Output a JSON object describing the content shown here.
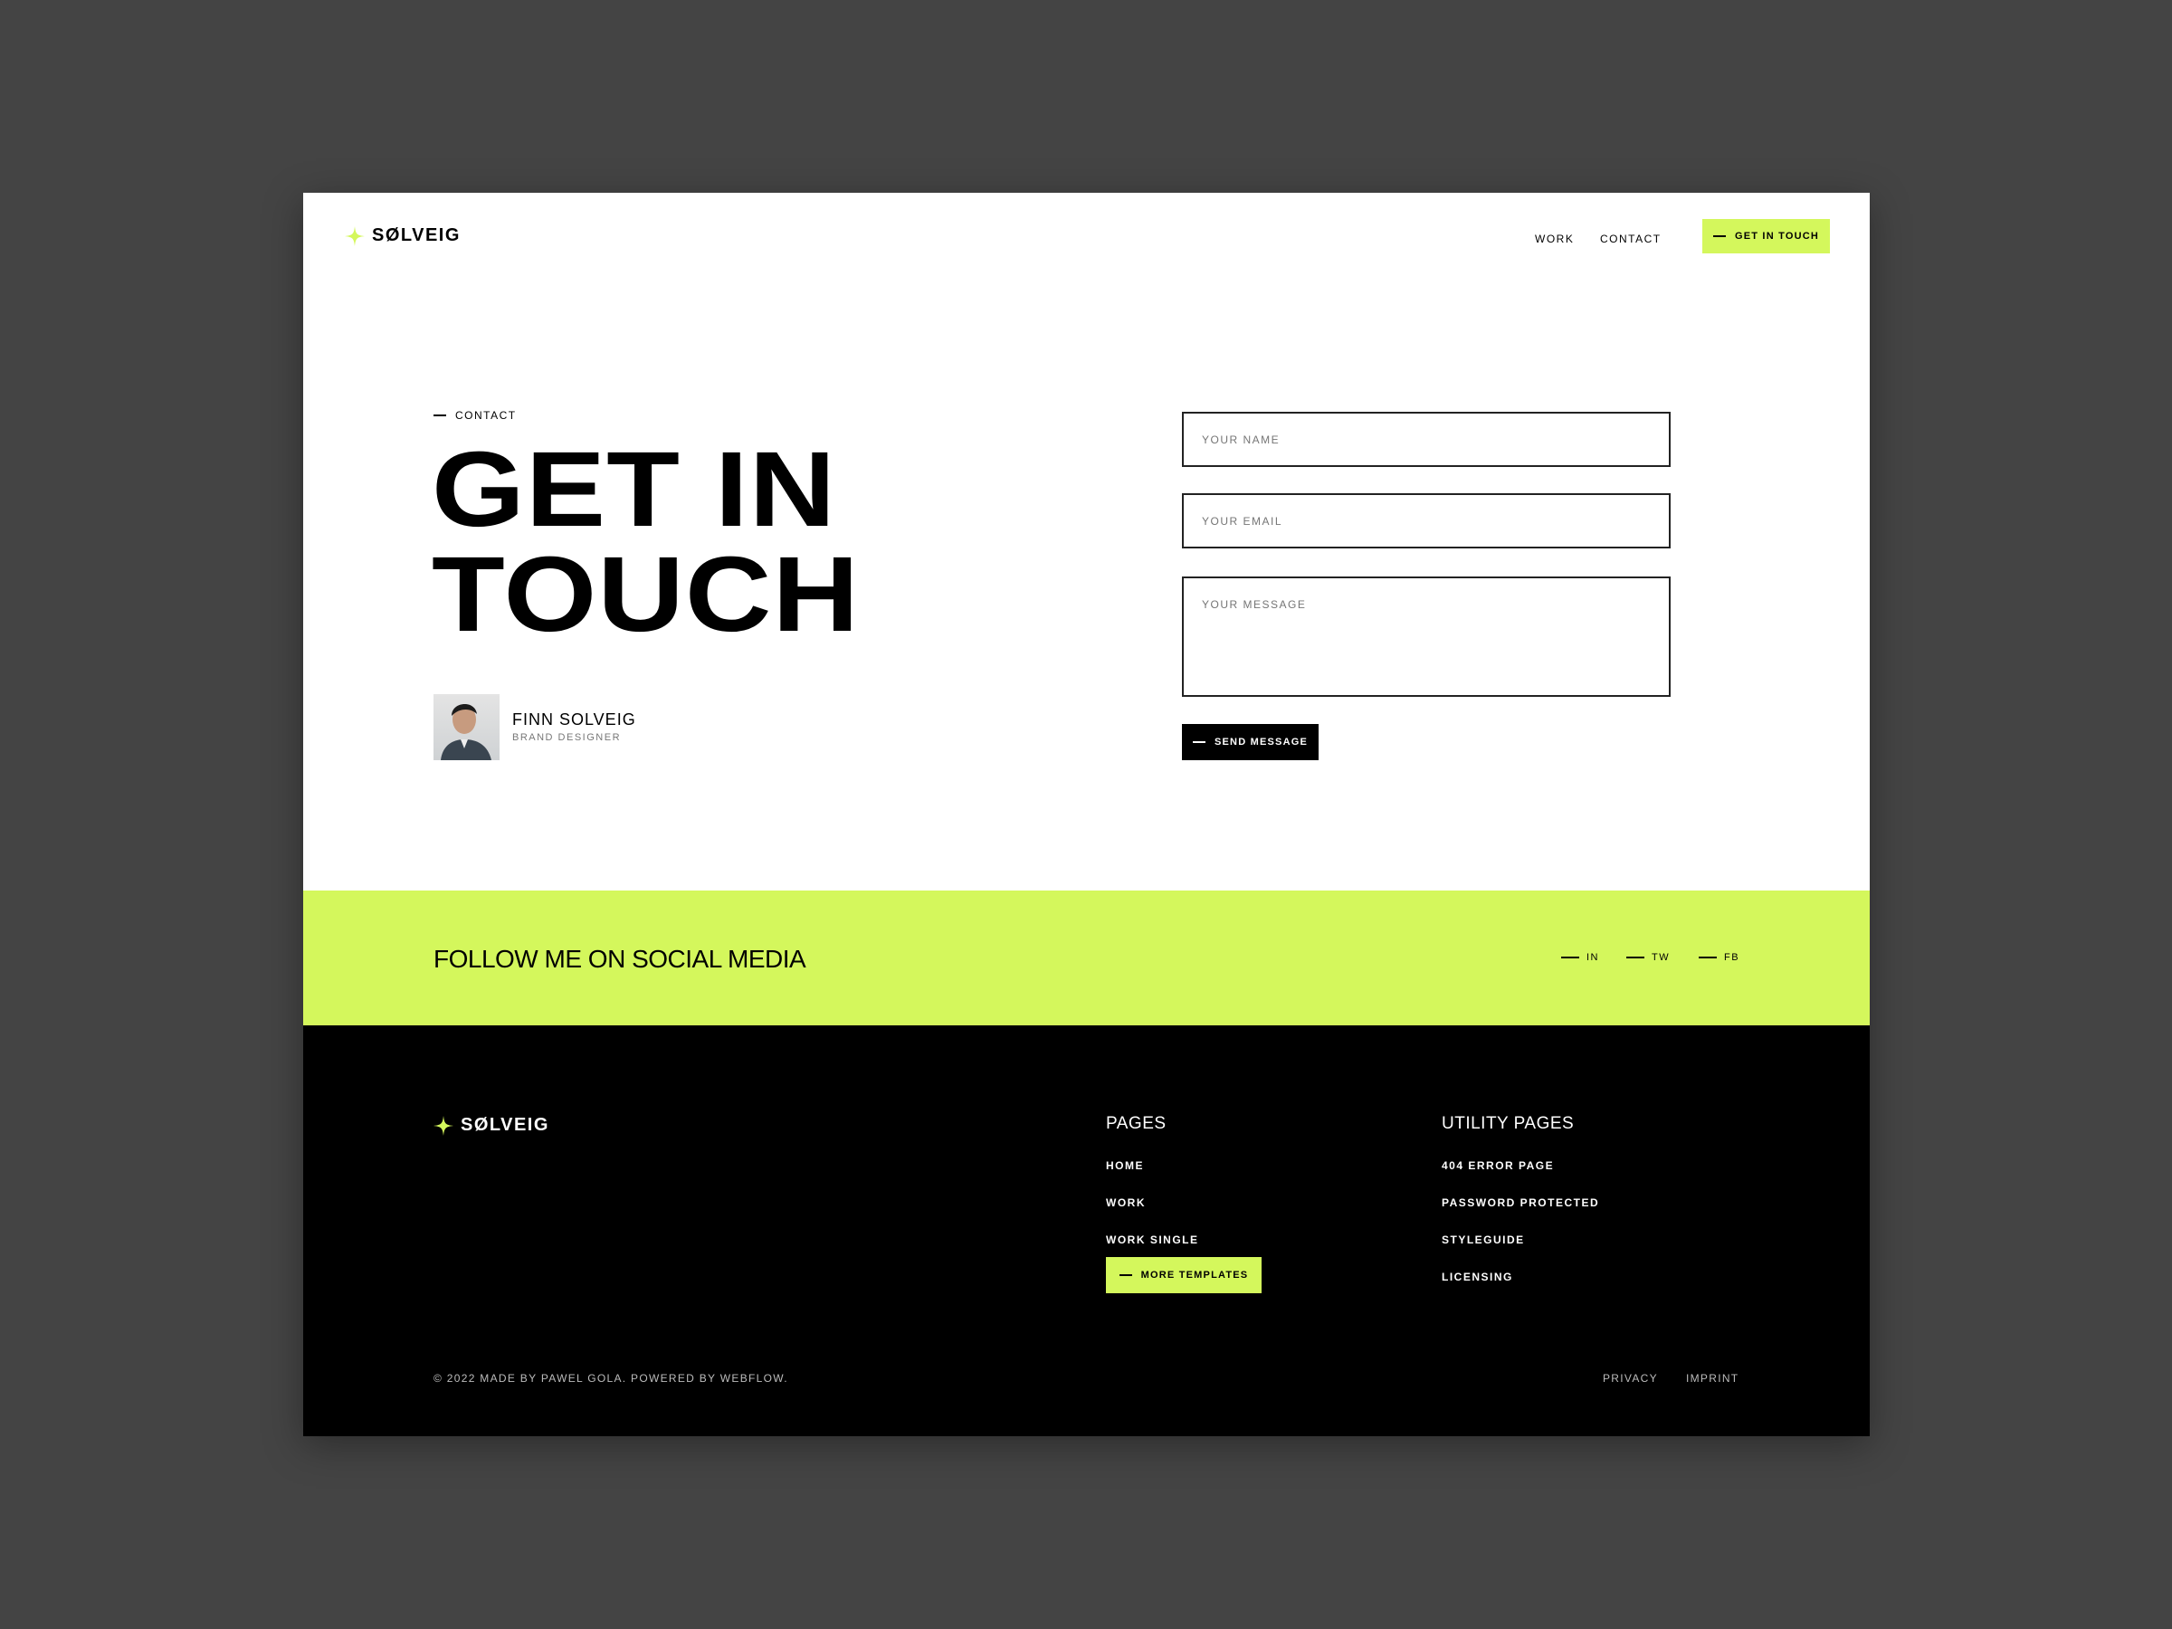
{
  "brand": {
    "name": "SØLVEIG",
    "accent": "#d4f75c"
  },
  "nav": {
    "items": [
      "WORK",
      "CONTACT"
    ],
    "cta": "GET IN TOUCH"
  },
  "hero": {
    "eyebrow": "CONTACT",
    "title_line1": "GET IN",
    "title_line2": "TOUCH"
  },
  "person": {
    "name": "FINN SOLVEIG",
    "role": "BRAND DESIGNER"
  },
  "form": {
    "name_placeholder": "YOUR NAME",
    "email_placeholder": "YOUR EMAIL",
    "message_placeholder": "YOUR MESSAGE",
    "submit": "SEND MESSAGE"
  },
  "social": {
    "title": "FOLLOW ME ON SOCIAL MEDIA",
    "links": [
      "IN",
      "TW",
      "FB"
    ]
  },
  "footer": {
    "pages_title": "PAGES",
    "pages": [
      "HOME",
      "WORK",
      "WORK SINGLE"
    ],
    "more_templates": "MORE TEMPLATES",
    "utility_title": "UTILITY PAGES",
    "utility": [
      "404 ERROR PAGE",
      "PASSWORD PROTECTED",
      "STYLEGUIDE",
      "LICENSING"
    ],
    "copyright": "© 2022 MADE BY PAWEL GOLA. POWERED BY WEBFLOW.",
    "legal": [
      "PRIVACY",
      "IMPRINT"
    ]
  }
}
